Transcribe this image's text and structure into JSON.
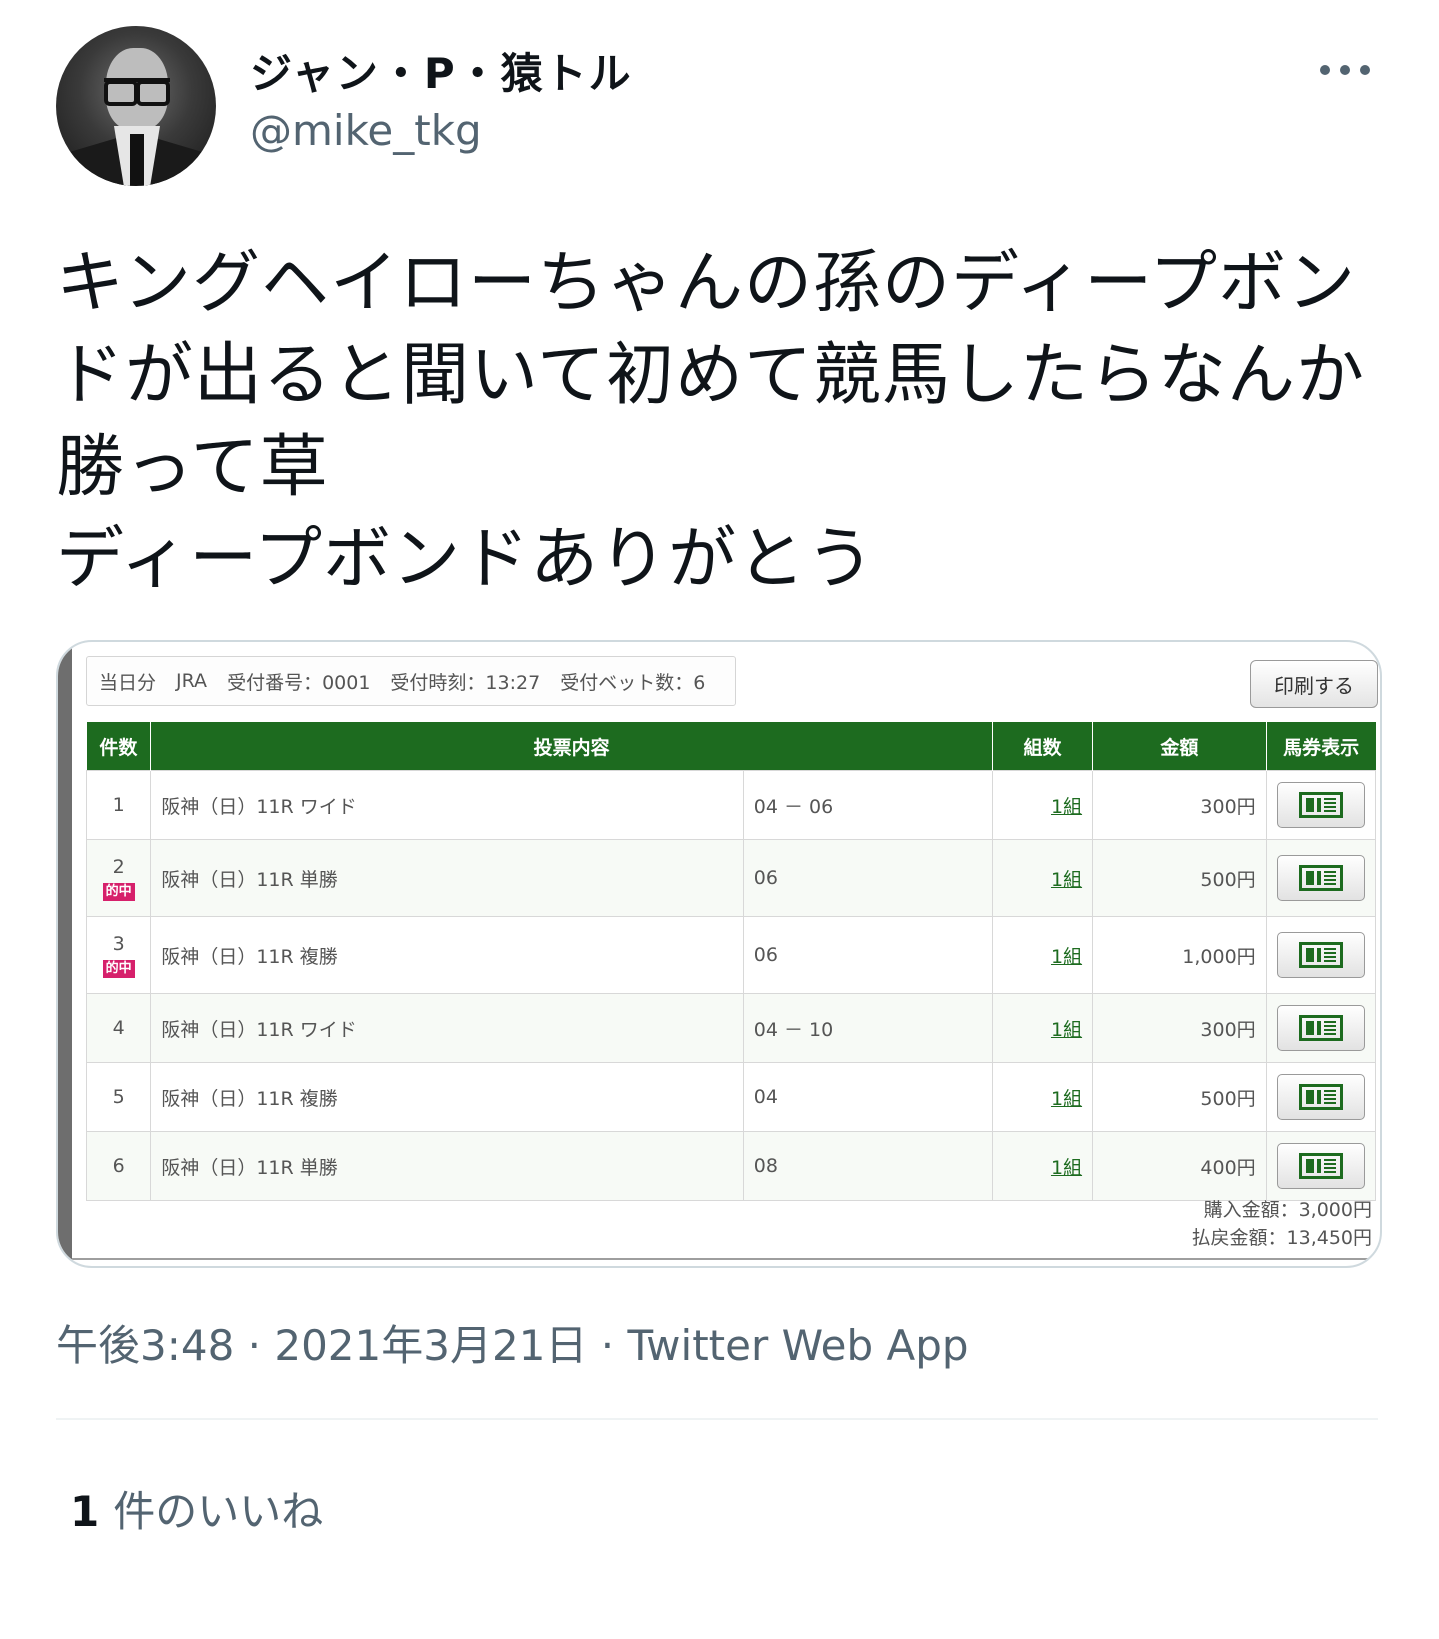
{
  "tweet": {
    "display_name": "ジャン・P・猿トル",
    "handle": "@mike_tkg",
    "text": "キングヘイローちゃんの孫のディープボンドが出ると聞いて初めて競馬したらなんか勝って草\nディープボンドありがとう",
    "timestamp": "午後3:48 · 2021年3月21日 · Twitter Web App",
    "likes_count": "1",
    "likes_label": "件のいいね",
    "icons": [
      "avatar",
      "more-icon"
    ]
  },
  "receipt": {
    "info": {
      "day": "当日分",
      "org": "JRA",
      "receipt_no": "受付番号：0001",
      "receipt_time": "受付時刻：13:27",
      "bet_count": "受付ベット数：6"
    },
    "print_button": "印刷する",
    "headers": [
      "件数",
      "投票内容",
      "組数",
      "金額",
      "馬券表示"
    ],
    "rows": [
      {
        "no": "1",
        "hit": "",
        "race": "阪神（日）11R ワイド",
        "horses": "04 － 06",
        "kumi": "1組",
        "amount": "300円"
      },
      {
        "no": "2",
        "hit": "的中",
        "race": "阪神（日）11R 単勝",
        "horses": "06",
        "kumi": "1組",
        "amount": "500円"
      },
      {
        "no": "3",
        "hit": "的中",
        "race": "阪神（日）11R 複勝",
        "horses": "06",
        "kumi": "1組",
        "amount": "1,000円"
      },
      {
        "no": "4",
        "hit": "",
        "race": "阪神（日）11R ワイド",
        "horses": "04 － 10",
        "kumi": "1組",
        "amount": "300円"
      },
      {
        "no": "5",
        "hit": "",
        "race": "阪神（日）11R 複勝",
        "horses": "04",
        "kumi": "1組",
        "amount": "500円"
      },
      {
        "no": "6",
        "hit": "",
        "race": "阪神（日）11R 単勝",
        "horses": "08",
        "kumi": "1組",
        "amount": "400円"
      }
    ],
    "totals": {
      "purchase": "購入金額：3,000円",
      "payout": "払戻金額：13,450円"
    },
    "colors": {
      "header_green": "#1d6b1f",
      "hit_badge": "#d6206b"
    }
  }
}
